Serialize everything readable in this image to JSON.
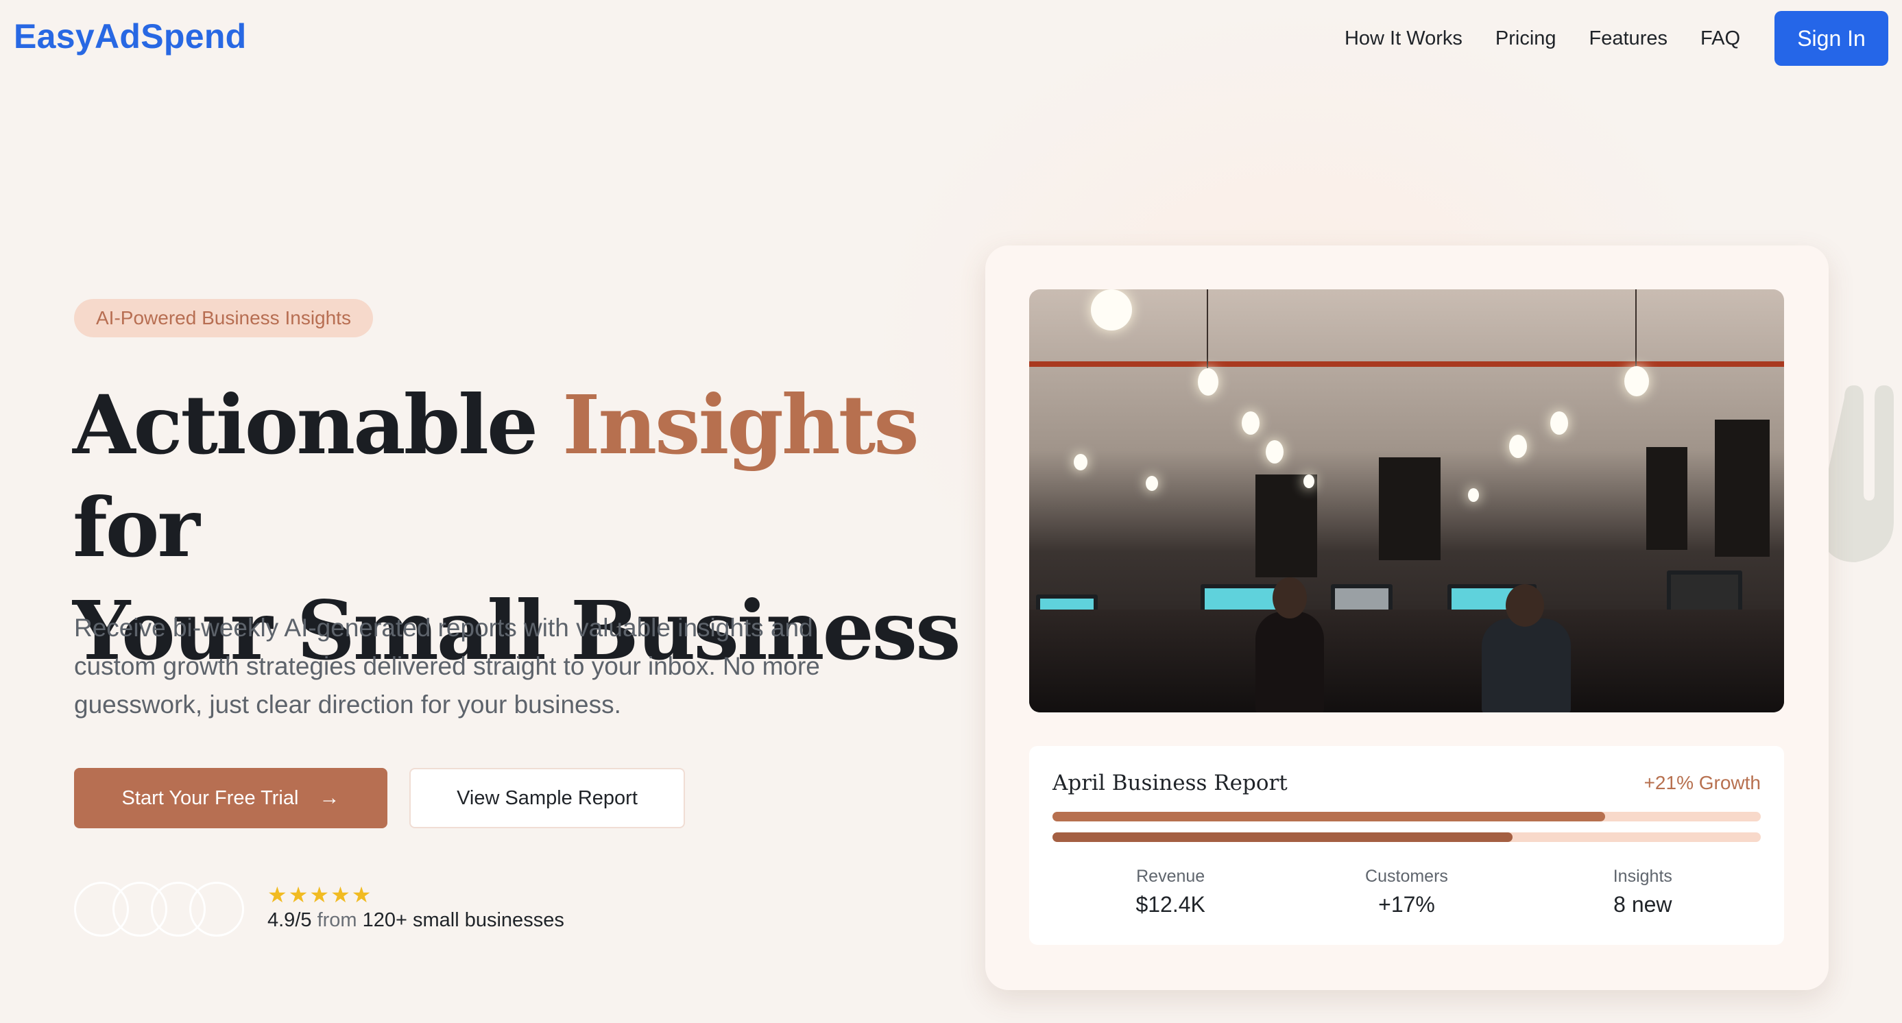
{
  "brand": {
    "name": "EasyAdSpend"
  },
  "nav": {
    "links": [
      "How It Works",
      "Pricing",
      "Features",
      "FAQ"
    ],
    "signin_label": "Sign In"
  },
  "hero": {
    "badge": "AI-Powered Business Insights",
    "headline": {
      "part1": "Actionable ",
      "accent": "Insights",
      "part2": " for",
      "line2": "Your Small Business"
    },
    "subcopy": "Receive bi-weekly AI-generated reports with valuable insights and custom growth strategies delivered straight to your inbox. No more guesswork, just clear direction for your business.",
    "primary_cta": "Start Your Free Trial",
    "secondary_cta": "View Sample Report",
    "stars": "★★★★★",
    "rating": {
      "score": "4.9/5",
      "from": "from",
      "count": "120+ small businesses"
    }
  },
  "report": {
    "title": "April Business Report",
    "growth": "+21% Growth",
    "progress": [
      0.78,
      0.65
    ],
    "stats": [
      {
        "label": "Revenue",
        "value": "$12.4K"
      },
      {
        "label": "Customers",
        "value": "+17%"
      },
      {
        "label": "Insights",
        "value": "8 new"
      }
    ]
  },
  "colors": {
    "brand": "#2868e3",
    "accent": "#b7704f",
    "signin": "#2566e8",
    "stars": "#f1bb22"
  }
}
